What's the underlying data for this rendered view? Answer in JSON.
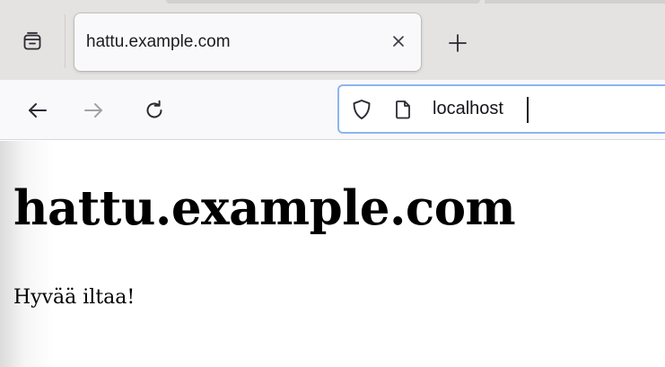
{
  "tab": {
    "title": "hattu.example.com",
    "close_icon": "close-icon"
  },
  "tabstrip": {
    "overview_icon": "tab-overview-icon",
    "new_tab_icon": "plus-icon"
  },
  "navigation": {
    "back_icon": "arrow-left-icon",
    "forward_icon": "arrow-right-icon",
    "reload_icon": "reload-icon"
  },
  "urlbar": {
    "value": "localhost",
    "security_icon": "shield-icon",
    "page_icon": "page-icon"
  },
  "page": {
    "heading": "hattu.example.com",
    "paragraph": "Hyvää iltaa!"
  },
  "colors": {
    "tabstrip_bg": "#e4e3e1",
    "toolbar_bg": "#f9f9fb",
    "urlbar_focus_border": "#8fb4ee"
  }
}
